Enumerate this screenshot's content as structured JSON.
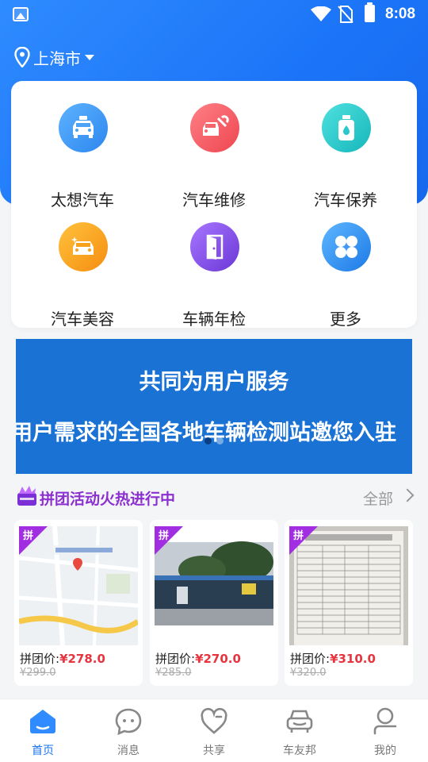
{
  "status_bar": {
    "time": "8:08"
  },
  "location": {
    "city": "上海市"
  },
  "services": [
    {
      "label": "太想汽车",
      "icon": "taxi-icon",
      "color": "#3d9af5"
    },
    {
      "label": "汽车维修",
      "icon": "car-repair-icon",
      "color": "#f25b63"
    },
    {
      "label": "汽车保养",
      "icon": "oil-bottle-icon",
      "color": "#27c9cb"
    },
    {
      "label": "汽车美容",
      "icon": "car-sparkle-icon",
      "color": "#f7a21c"
    },
    {
      "label": "车辆年检",
      "icon": "door-icon",
      "color": "#8b4ce8"
    },
    {
      "label": "更多",
      "icon": "more-grid-icon",
      "color": "#2f92f2"
    }
  ],
  "banner": {
    "line1": "共同为用户服务",
    "line2": "用户需求的全国各地车辆检测站邀您入驻",
    "dot_count": 2,
    "active_dot": 0
  },
  "group_buy": {
    "title": "拼团活动火热进行中",
    "all_label": "全部",
    "tag": "拼",
    "price_label": "拼团价:",
    "items": [
      {
        "price": "¥278.0",
        "original": "¥299.0",
        "image": "map-thumbnail"
      },
      {
        "price": "¥270.0",
        "original": "¥285.0",
        "image": "inspection-station-photo"
      },
      {
        "price": "¥310.0",
        "original": "¥320.0",
        "image": "price-list-photo"
      }
    ]
  },
  "tabbar": [
    {
      "label": "首页",
      "icon": "home-icon",
      "active": true
    },
    {
      "label": "消息",
      "icon": "message-icon",
      "active": false
    },
    {
      "label": "共享",
      "icon": "heart-icon",
      "active": false
    },
    {
      "label": "车友邦",
      "icon": "car-club-icon",
      "active": false
    },
    {
      "label": "我的",
      "icon": "profile-icon",
      "active": false
    }
  ]
}
